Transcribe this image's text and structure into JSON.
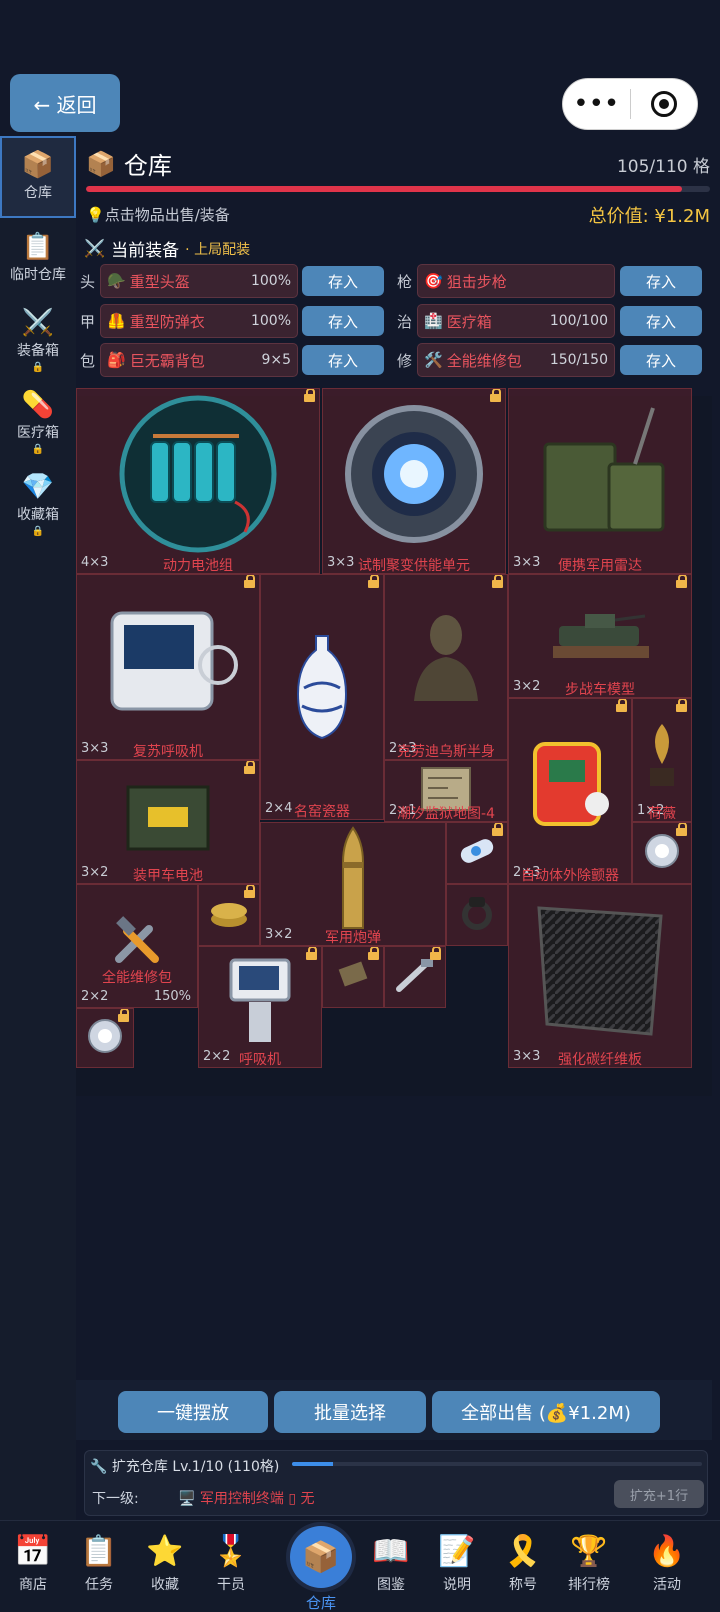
{
  "top": {
    "back_label": "← 返回"
  },
  "sidebar": {
    "items": [
      {
        "label": "仓库",
        "icon": "box-icon"
      },
      {
        "label": "临时仓库",
        "icon": "clipboard-icon"
      },
      {
        "label": "装备箱",
        "icon": "crossed-swords-icon"
      },
      {
        "label": "医疗箱",
        "icon": "pill-icon"
      },
      {
        "label": "收藏箱",
        "icon": "diamond-icon"
      }
    ]
  },
  "header": {
    "title": "仓库",
    "capacity": "105/110 格",
    "capacity_fraction": 0.955,
    "hint": "点击物品出售/装备",
    "total_value": "总价值: ¥1.2M"
  },
  "equipment": {
    "title": "当前装备",
    "subtitle": "· 上局配装",
    "store_label": "存入",
    "slots": [
      {
        "label": "头",
        "name": "重型头盔",
        "value": "100%"
      },
      {
        "label": "甲",
        "name": "重型防弹衣",
        "value": "100%"
      },
      {
        "label": "包",
        "name": "巨无霸背包",
        "value": "9×5"
      },
      {
        "label": "枪",
        "name": "狙击步枪",
        "value": ""
      },
      {
        "label": "治",
        "name": "医疗箱",
        "value": "100/100"
      },
      {
        "label": "修",
        "name": "全能维修包",
        "value": "150/150"
      }
    ]
  },
  "grid_items": [
    {
      "name": "动力电池组",
      "size": "4×3"
    },
    {
      "name": "试制聚变供能单元",
      "size": "3×3"
    },
    {
      "name": "便携军用雷达",
      "size": "3×3"
    },
    {
      "name": "复苏呼吸机",
      "size": "3×3"
    },
    {
      "name": "名窑瓷器",
      "size": "2×4"
    },
    {
      "name": "克劳迪乌斯半身",
      "size": "2×3"
    },
    {
      "name": "步战车模型",
      "size": "3×2"
    },
    {
      "name": "潮汐监狱地图-4",
      "size": "2×1"
    },
    {
      "name": "自动体外除颤器",
      "size": "2×3"
    },
    {
      "name": "荷薇",
      "size": "1×2"
    },
    {
      "name": "装甲车电池",
      "size": "3×2"
    },
    {
      "name": "军用炮弹",
      "size": "3×2"
    },
    {
      "name": "全能维修包",
      "size": "2×2",
      "percent": "150%"
    },
    {
      "name": "呼吸机",
      "size": "2×2"
    },
    {
      "name": "强化碳纤维板",
      "size": "3×3"
    }
  ],
  "actions": {
    "auto_place": "一键摆放",
    "batch_select": "批量选择",
    "sell_all": "全部出售 (💰¥1.2M)"
  },
  "expand": {
    "title": "扩充仓库 Lv.1/10 (110格)",
    "progress_fraction": 0.1,
    "next_label": "下一级:",
    "next_item": "军用控制终端 ▯ 无",
    "button": "扩充+1行"
  },
  "nav": [
    {
      "label": "商店",
      "icon": "calendar-shop-icon"
    },
    {
      "label": "任务",
      "icon": "clipboard-icon"
    },
    {
      "label": "收藏",
      "icon": "star-icon"
    },
    {
      "label": "干员",
      "icon": "medal-icon"
    },
    {
      "label": "仓库",
      "icon": "box-icon"
    },
    {
      "label": "图鉴",
      "icon": "book-icon"
    },
    {
      "label": "说明",
      "icon": "memo-icon"
    },
    {
      "label": "称号",
      "icon": "ribbon-icon"
    },
    {
      "label": "排行榜",
      "icon": "trophy-icon"
    },
    {
      "label": "活动",
      "icon": "fire-icon"
    }
  ],
  "colors": {
    "accent": "#4d86b8",
    "danger": "#e0344a",
    "gold": "#f4c542",
    "item_red": "#e0444e"
  }
}
